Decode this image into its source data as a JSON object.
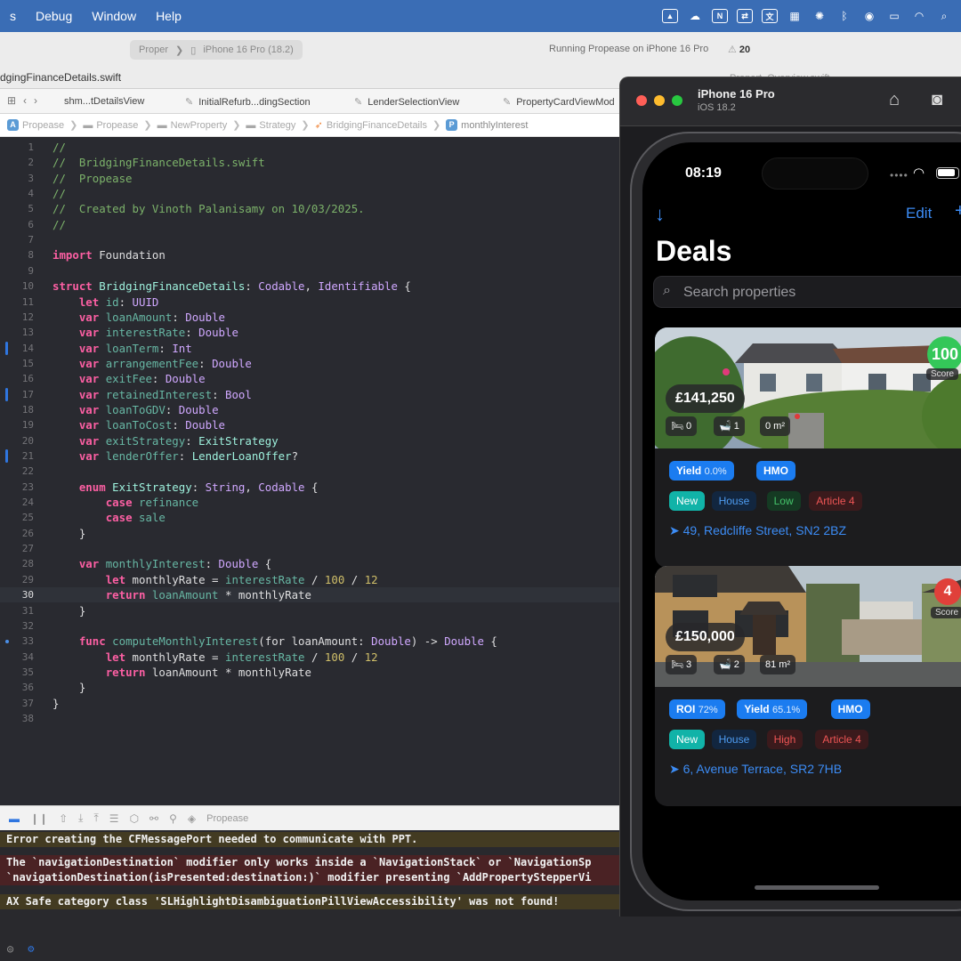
{
  "menubar": {
    "items": [
      "s",
      "Debug",
      "Window",
      "Help"
    ]
  },
  "toolbar": {
    "scheme": "Proper",
    "device": "iPhone 16 Pro (18.2)",
    "status": "Running Propease on iPhone 16 Pro",
    "warnings": "20",
    "filename": "dgingFinanceDetails.swift",
    "ghost_tab": "Propert_Overview.swift"
  },
  "tabs": [
    "shm...tDetailsView",
    "InitialRefurb...dingSection",
    "LenderSelectionView",
    "PropertyCardViewMod"
  ],
  "breadcrumb": [
    "Propease",
    "Propease",
    "NewProperty",
    "Strategy",
    "BridgingFinanceDetails",
    "monthlyInterest"
  ],
  "code": {
    "active_line": 30,
    "lines": [
      [
        [
          "c-com",
          "//"
        ]
      ],
      [
        [
          "c-com",
          "//  BridgingFinanceDetails.swift"
        ]
      ],
      [
        [
          "c-com",
          "//  Propease"
        ]
      ],
      [
        [
          "c-com",
          "//"
        ]
      ],
      [
        [
          "c-com",
          "//  Created by Vinoth Palanisamy on 10/03/2025."
        ]
      ],
      [
        [
          "c-com",
          "//"
        ]
      ],
      [],
      [
        [
          "c-kw",
          "import"
        ],
        [
          "",
          " Foundation"
        ]
      ],
      [],
      [
        [
          "c-kw",
          "struct"
        ],
        [
          "",
          " "
        ],
        [
          "c-cls",
          "BridgingFinanceDetails"
        ],
        [
          "",
          ": "
        ],
        [
          "c-type",
          "Codable"
        ],
        [
          "",
          ", "
        ],
        [
          "c-type",
          "Identifiable"
        ],
        [
          "",
          " {"
        ]
      ],
      [
        [
          "",
          "    "
        ],
        [
          "c-kw",
          "let"
        ],
        [
          "",
          " "
        ],
        [
          "c-prop",
          "id"
        ],
        [
          "",
          ": "
        ],
        [
          "c-type",
          "UUID"
        ]
      ],
      [
        [
          "",
          "    "
        ],
        [
          "c-kw",
          "var"
        ],
        [
          "",
          " "
        ],
        [
          "c-prop",
          "loanAmount"
        ],
        [
          "",
          ": "
        ],
        [
          "c-type",
          "Double"
        ]
      ],
      [
        [
          "",
          "    "
        ],
        [
          "c-kw",
          "var"
        ],
        [
          "",
          " "
        ],
        [
          "c-prop",
          "interestRate"
        ],
        [
          "",
          ": "
        ],
        [
          "c-type",
          "Double"
        ]
      ],
      [
        [
          "",
          "    "
        ],
        [
          "c-kw",
          "var"
        ],
        [
          "",
          " "
        ],
        [
          "c-prop",
          "loanTerm"
        ],
        [
          "",
          ": "
        ],
        [
          "c-type",
          "Int"
        ]
      ],
      [
        [
          "",
          "    "
        ],
        [
          "c-kw",
          "var"
        ],
        [
          "",
          " "
        ],
        [
          "c-prop",
          "arrangementFee"
        ],
        [
          "",
          ": "
        ],
        [
          "c-type",
          "Double"
        ]
      ],
      [
        [
          "",
          "    "
        ],
        [
          "c-kw",
          "var"
        ],
        [
          "",
          " "
        ],
        [
          "c-prop",
          "exitFee"
        ],
        [
          "",
          ": "
        ],
        [
          "c-type",
          "Double"
        ]
      ],
      [
        [
          "",
          "    "
        ],
        [
          "c-kw",
          "var"
        ],
        [
          "",
          " "
        ],
        [
          "c-prop",
          "retainedInterest"
        ],
        [
          "",
          ": "
        ],
        [
          "c-type",
          "Bool"
        ]
      ],
      [
        [
          "",
          "    "
        ],
        [
          "c-kw",
          "var"
        ],
        [
          "",
          " "
        ],
        [
          "c-prop",
          "loanToGDV"
        ],
        [
          "",
          ": "
        ],
        [
          "c-type",
          "Double"
        ]
      ],
      [
        [
          "",
          "    "
        ],
        [
          "c-kw",
          "var"
        ],
        [
          "",
          " "
        ],
        [
          "c-prop",
          "loanToCost"
        ],
        [
          "",
          ": "
        ],
        [
          "c-type",
          "Double"
        ]
      ],
      [
        [
          "",
          "    "
        ],
        [
          "c-kw",
          "var"
        ],
        [
          "",
          " "
        ],
        [
          "c-prop",
          "exitStrategy"
        ],
        [
          "",
          ": "
        ],
        [
          "c-cls",
          "ExitStrategy"
        ]
      ],
      [
        [
          "",
          "    "
        ],
        [
          "c-kw",
          "var"
        ],
        [
          "",
          " "
        ],
        [
          "c-prop",
          "lenderOffer"
        ],
        [
          "",
          ": "
        ],
        [
          "c-cls",
          "LenderLoanOffer"
        ],
        [
          "",
          "?"
        ]
      ],
      [],
      [
        [
          "",
          "    "
        ],
        [
          "c-kw",
          "enum"
        ],
        [
          "",
          " "
        ],
        [
          "c-cls",
          "ExitStrategy"
        ],
        [
          "",
          ": "
        ],
        [
          "c-type",
          "String"
        ],
        [
          "",
          ", "
        ],
        [
          "c-type",
          "Codable"
        ],
        [
          "",
          " {"
        ]
      ],
      [
        [
          "",
          "        "
        ],
        [
          "c-kw",
          "case"
        ],
        [
          "",
          " "
        ],
        [
          "c-prop",
          "refinance"
        ]
      ],
      [
        [
          "",
          "        "
        ],
        [
          "c-kw",
          "case"
        ],
        [
          "",
          " "
        ],
        [
          "c-prop",
          "sale"
        ]
      ],
      [
        [
          "",
          "    }"
        ]
      ],
      [],
      [
        [
          "",
          "    "
        ],
        [
          "c-kw",
          "var"
        ],
        [
          "",
          " "
        ],
        [
          "c-prop",
          "monthlyInterest"
        ],
        [
          "",
          ": "
        ],
        [
          "c-type",
          "Double"
        ],
        [
          "",
          " {"
        ]
      ],
      [
        [
          "",
          "        "
        ],
        [
          "c-kw",
          "let"
        ],
        [
          "",
          " monthlyRate = "
        ],
        [
          "c-prop",
          "interestRate"
        ],
        [
          "",
          " / "
        ],
        [
          "c-num",
          "100"
        ],
        [
          "",
          " / "
        ],
        [
          "c-num",
          "12"
        ]
      ],
      [
        [
          "",
          "        "
        ],
        [
          "c-kw",
          "return"
        ],
        [
          "",
          " "
        ],
        [
          "c-prop",
          "loanAmount"
        ],
        [
          "",
          " * monthlyRate"
        ]
      ],
      [
        [
          "",
          "    }"
        ]
      ],
      [],
      [
        [
          "",
          "    "
        ],
        [
          "c-kw",
          "func"
        ],
        [
          "",
          " "
        ],
        [
          "c-fn",
          "computeMonthlyInterest"
        ],
        [
          "",
          "(for loanAmount: "
        ],
        [
          "c-type",
          "Double"
        ],
        [
          "",
          ") -> "
        ],
        [
          "c-type",
          "Double"
        ],
        [
          "",
          " {"
        ]
      ],
      [
        [
          "",
          "        "
        ],
        [
          "c-kw",
          "let"
        ],
        [
          "",
          " monthlyRate = "
        ],
        [
          "c-prop",
          "interestRate"
        ],
        [
          "",
          " / "
        ],
        [
          "c-num",
          "100"
        ],
        [
          "",
          " / "
        ],
        [
          "c-num",
          "12"
        ]
      ],
      [
        [
          "",
          "        "
        ],
        [
          "c-kw",
          "return"
        ],
        [
          "",
          " loanAmount * monthlyRate"
        ]
      ],
      [
        [
          "",
          "    }"
        ]
      ],
      [
        [
          "",
          "}"
        ]
      ],
      []
    ],
    "change_marks": [
      14,
      17,
      21
    ],
    "breakpoint_dot": 33
  },
  "debugbar": {
    "target": "Propease"
  },
  "console": {
    "lines": [
      {
        "style": "yel",
        "text": "Error creating the CFMessagePort needed to communicate with PPT."
      },
      {
        "style": "red",
        "text": "The `navigationDestination` modifier only works inside a `NavigationStack` or `NavigationSp"
      },
      {
        "style": "red",
        "text": "`navigationDestination(isPresented:destination:)` modifier presenting `AddPropertyStepperVi"
      },
      {
        "style": "yel",
        "text": "AX Safe category class 'SLHighlightDisambiguationPillViewAccessibility' was not found!"
      }
    ]
  },
  "simulator": {
    "title": "iPhone 16 Pro",
    "subtitle": "iOS 18.2"
  },
  "phone": {
    "time": "08:19",
    "nav": {
      "edit": "Edit"
    },
    "title": "Deals",
    "search_placeholder": "Search properties",
    "cards": [
      {
        "price": "£141,250",
        "beds": "0",
        "baths": "1",
        "area": "0 m²",
        "score": "100",
        "score_label": "Score",
        "score_color": "#34c759",
        "tags_row1": [
          {
            "label": "Yield",
            "sub": "0.0%",
            "style": "p-blue"
          },
          {
            "label": "HMO",
            "sub": "",
            "style": "p-blue"
          }
        ],
        "tags_row2": [
          {
            "label": "New",
            "style": "p-teal"
          },
          {
            "label": "House",
            "style": "p-navy"
          },
          {
            "label": "Low",
            "style": "p-green"
          },
          {
            "label": "Article 4",
            "style": "p-red"
          }
        ],
        "address": "49, Redcliffe Street, SN2 2BZ"
      },
      {
        "price": "£150,000",
        "beds": "3",
        "baths": "2",
        "area": "81 m²",
        "score": "4",
        "score_label": "Score",
        "score_color": "#e0403a",
        "tags_row1": [
          {
            "label": "ROI",
            "sub": "72%",
            "style": "p-blue"
          },
          {
            "label": "Yield",
            "sub": "65.1%",
            "style": "p-blue"
          },
          {
            "label": "HMO",
            "sub": "",
            "style": "p-blue"
          }
        ],
        "tags_row2": [
          {
            "label": "New",
            "style": "p-teal"
          },
          {
            "label": "House",
            "style": "p-navy"
          },
          {
            "label": "High",
            "style": "p-red"
          },
          {
            "label": "Article 4",
            "style": "p-red"
          }
        ],
        "address": "6, Avenue Terrace, SR2 7HB"
      }
    ]
  }
}
